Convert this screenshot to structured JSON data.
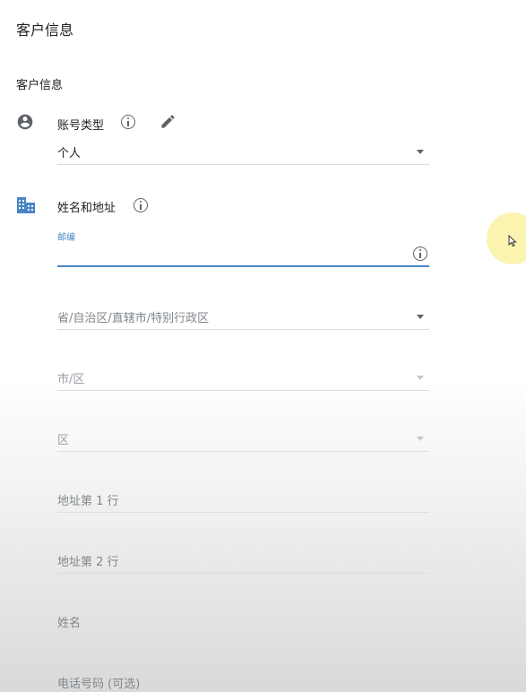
{
  "header": {
    "title": "客户信息"
  },
  "section": {
    "title": "客户信息"
  },
  "account": {
    "label": "账号类型",
    "value": "个人"
  },
  "name_address": {
    "label": "姓名和地址",
    "postal_label": "邮编",
    "province_placeholder": "省/自治区/直辖市/特别行政区",
    "city_placeholder": "市/区",
    "district_placeholder": "区",
    "address1_placeholder": "地址第 1 行",
    "address2_placeholder": "地址第 2 行",
    "name_placeholder": "姓名",
    "phone_placeholder": "电话号码 (可选)"
  },
  "icons": {
    "account": "account-circle-icon",
    "info": "info-icon",
    "edit": "pencil-icon",
    "address": "business-icon",
    "cursor": "mouse-pointer-icon"
  },
  "colors": {
    "accent": "#4a86c5",
    "icon": "#5f6368",
    "cursor_highlight": "#faf096"
  }
}
